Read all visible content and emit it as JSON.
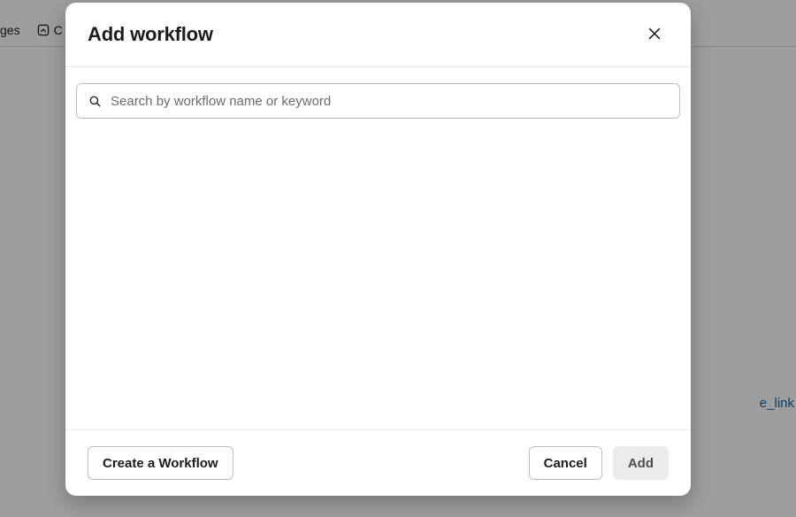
{
  "background": {
    "tab1_label": "ges",
    "tab2_label": "C",
    "link_snippet": "e_link"
  },
  "modal": {
    "title": "Add workflow",
    "search": {
      "placeholder": "Search by workflow name or keyword",
      "value": ""
    },
    "buttons": {
      "create": "Create a Workflow",
      "cancel": "Cancel",
      "add": "Add"
    }
  }
}
